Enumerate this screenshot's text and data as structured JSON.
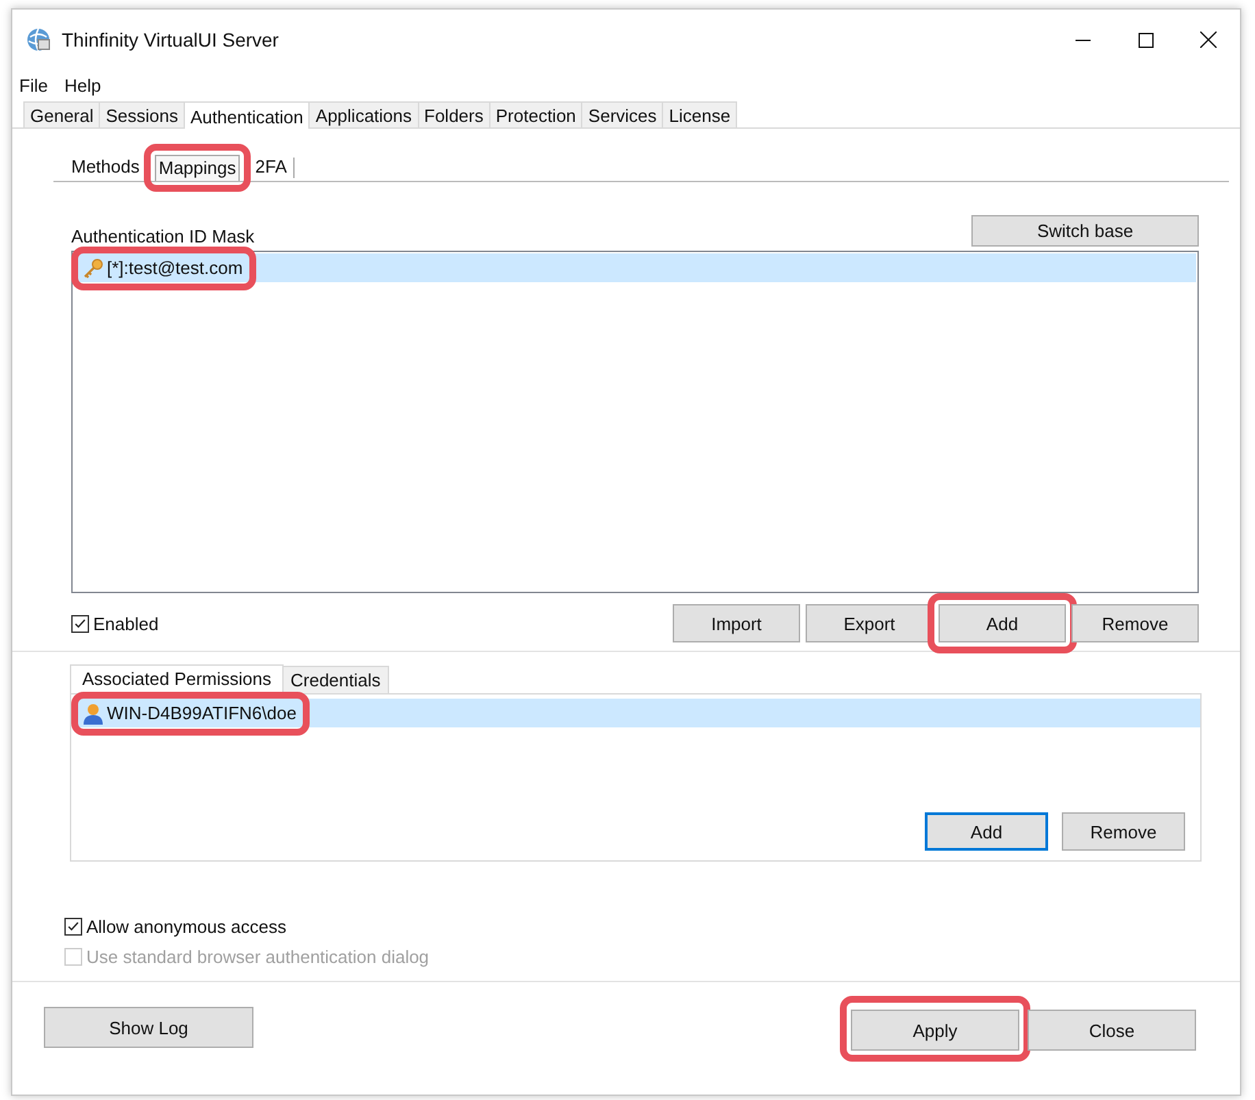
{
  "window": {
    "title": "Thinfinity VirtualUI Server"
  },
  "menu": [
    "File",
    "Help"
  ],
  "tabs": [
    {
      "label": "General",
      "selected": false
    },
    {
      "label": "Sessions",
      "selected": false
    },
    {
      "label": "Authentication",
      "selected": true
    },
    {
      "label": "Applications",
      "selected": false
    },
    {
      "label": "Folders",
      "selected": false
    },
    {
      "label": "Protection",
      "selected": false
    },
    {
      "label": "Services",
      "selected": false
    },
    {
      "label": "License",
      "selected": false
    }
  ],
  "subtabs": [
    {
      "label": "Methods",
      "selected": false,
      "highlighted": false
    },
    {
      "label": "Mappings",
      "selected": true,
      "highlighted": true
    },
    {
      "label": "2FA",
      "selected": false,
      "highlighted": false
    }
  ],
  "mappings": {
    "label": "Authentication ID Mask",
    "switch_button": "Switch base",
    "rows": [
      {
        "text": "[*]:test@test.com",
        "selected": true,
        "highlighted": true
      }
    ],
    "enabled": {
      "label": "Enabled",
      "checked": true
    },
    "buttons": [
      {
        "label": "Import",
        "highlighted": false
      },
      {
        "label": "Export",
        "highlighted": false
      },
      {
        "label": "Add",
        "highlighted": true
      },
      {
        "label": "Remove",
        "highlighted": false
      }
    ]
  },
  "permissions": {
    "tabs": [
      {
        "label": "Associated Permissions",
        "selected": true
      },
      {
        "label": "Credentials",
        "selected": false
      }
    ],
    "rows": [
      {
        "text": "WIN-D4B99ATIFN6\\doe",
        "selected": true,
        "highlighted": true
      }
    ],
    "buttons": [
      {
        "label": "Add",
        "default": true
      },
      {
        "label": "Remove",
        "default": false
      }
    ]
  },
  "options": [
    {
      "label": "Allow anonymous access",
      "checked": true,
      "disabled": false
    },
    {
      "label": "Use standard browser authentication dialog",
      "checked": false,
      "disabled": true
    }
  ],
  "footer": {
    "buttons": [
      {
        "label": "Show Log",
        "highlighted": false
      },
      {
        "label": "Apply",
        "highlighted": true
      },
      {
        "label": "Close",
        "highlighted": false
      }
    ]
  }
}
